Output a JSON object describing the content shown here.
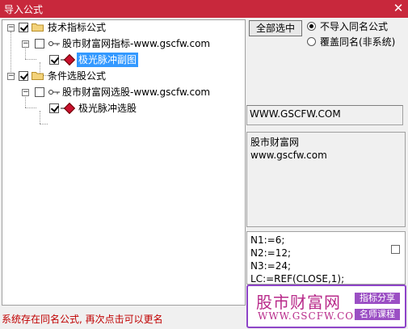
{
  "window": {
    "title": "导入公式",
    "close_glyph": "✕"
  },
  "tree": {
    "groups": [
      {
        "label": "技术指标公式",
        "checked": true,
        "child": {
          "label": "股市财富网指标-www.gscfw.com",
          "checked": false,
          "leaf": {
            "label": "极光脉冲副图",
            "checked": true,
            "selected": true
          }
        }
      },
      {
        "label": "条件选股公式",
        "checked": true,
        "child": {
          "label": "股市财富网选股-www.gscfw.com",
          "checked": false,
          "leaf": {
            "label": "极光脉冲选股",
            "checked": true,
            "selected": false
          }
        }
      }
    ]
  },
  "controls": {
    "select_all": "全部选中",
    "radio_skip": "不导入同名公式",
    "radio_overwrite": "覆盖同名(非系统)"
  },
  "panel": {
    "url": "WWW.GSCFW.COM",
    "info_line1": "股市财富网",
    "info_line2": "www.gscfw.com",
    "code_lines": [
      "N1:=6;",
      "N2:=12;",
      "N3:=24;",
      "LC:=REF(CLOSE,1);"
    ]
  },
  "status": "系统存在同名公式, 再次点击可以更名",
  "brand": {
    "name": "股市财富网",
    "url": "WWW.GSCFW.COM",
    "tag1": "指标分享",
    "tag2": "名师课程"
  },
  "colors": {
    "titlebar": "#c8283c",
    "selection": "#3399ff",
    "status": "#c00000",
    "brand": "#b82a8a"
  }
}
